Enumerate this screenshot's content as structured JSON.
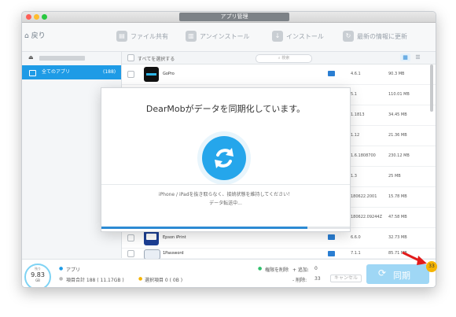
{
  "window": {
    "title": "アプリ管理"
  },
  "toolbar": {
    "back": "戻り",
    "file_share": "ファイル共有",
    "uninstall": "アンインストール",
    "install": "インストール",
    "update": "最新の情報に更新"
  },
  "sidebar": {
    "all_apps": {
      "label": "全てのアプリ",
      "count": "(188)"
    }
  },
  "list": {
    "select_all": "すべてを選択する",
    "search_placeholder": "検索",
    "rows": [
      {
        "name": "GoPro",
        "version": "4.6.1",
        "size": "90.3 MB"
      },
      {
        "name": "",
        "version": "5.1",
        "size": "110.01 MB"
      },
      {
        "name": "",
        "version": "1.1813",
        "size": "34.45 MB"
      },
      {
        "name": "",
        "version": "1.12",
        "size": "21.36 MB"
      },
      {
        "name": "",
        "version": "1.6.1808700",
        "size": "230.12 MB"
      },
      {
        "name": "",
        "version": "1.3",
        "size": "25 MB"
      },
      {
        "name": "",
        "version": "180622.2001",
        "size": "15.78 MB"
      },
      {
        "name": "",
        "version": "180622.09244Z",
        "size": "47.58 MB"
      },
      {
        "name": "Epson iPrint",
        "version": "6.6.0",
        "size": "32.73 MB"
      },
      {
        "name": "1Password",
        "version": "7.1.1",
        "size": "85.71 MB"
      }
    ]
  },
  "modal": {
    "title": "DearMobがデータを同期化しています。",
    "message": "iPhone / iPadを抜き取らなく、接続状態を維持してください！",
    "sub": "データ転送中...",
    "progress": 0.83
  },
  "footer": {
    "gauge_label": "残り",
    "gauge_value": "9.83",
    "gauge_unit": "GB",
    "apps_label": "アプリ",
    "total_label": "項目合計 188 ( 11.17GB )",
    "selected_label": "選択項目 0 ( 0B )",
    "deleted_label": "権限を削除",
    "added_label": "+ 追加:",
    "added_value": "0",
    "removed_label": "- 削除:",
    "removed_value": "33",
    "cancel": "キャンセル",
    "sync": "同期"
  },
  "badge": "33",
  "colors": {
    "accent": "#1e9be6",
    "sync_button": "#9fd7f5",
    "badge": "#f6b400"
  }
}
